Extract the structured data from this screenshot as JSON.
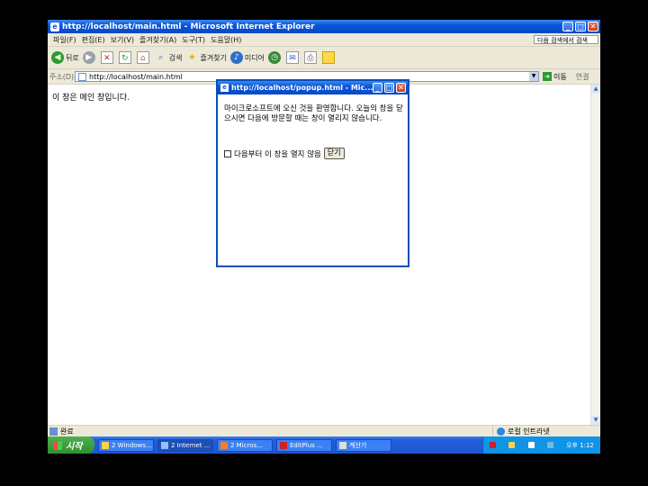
{
  "main_window": {
    "title": "http://localhost/main.html - Microsoft Internet Explorer",
    "menu": [
      "파일(F)",
      "편집(E)",
      "보기(V)",
      "즐겨찾기(A)",
      "도구(T)",
      "도움말(H)"
    ],
    "menu_right": "다음 검색에서 검색",
    "toolbar": {
      "back_label": "뒤로",
      "search_label": "검색",
      "favorites_label": "즐겨찾기",
      "media_label": "미디어"
    },
    "address": {
      "label": "주소(D)",
      "value": "http://localhost/main.html",
      "go_label": "이동",
      "links_label": "연결"
    },
    "content_text": "이 창은 메인 창입니다.",
    "status_text": "완료",
    "zone_text": "로컬 인트라넷"
  },
  "popup": {
    "title": "http://localhost/popup.html - Mic...",
    "message": "마이크로소프트에 오신 것을 환영합니다. 오늘의 창을 닫으시면 다음에 방문할 때는 창이 열리지 않습니다.",
    "checkbox_label": "다음부터 이 창을 열지 않음",
    "close_button": "닫기"
  },
  "taskbar": {
    "start_label": "시작",
    "tasks": [
      "2 Windows...",
      "2 Internet ...",
      "2 Micros...",
      "EditPlus ...",
      "계산기"
    ],
    "active_task_index": 1,
    "time": "오후 1:12"
  },
  "colors": {
    "titlebar_blue": "#0a55d8",
    "taskbar_blue": "#245edb",
    "start_green": "#2f8f2f",
    "xp_beige": "#ece9d8"
  },
  "icons": [
    "ie-icon",
    "back-icon",
    "forward-icon",
    "stop-icon",
    "refresh-icon",
    "home-icon",
    "search-icon",
    "favorites-star-icon",
    "media-icon",
    "history-icon",
    "mail-icon",
    "print-icon",
    "edit-icon",
    "go-arrow-icon",
    "globe-icon"
  ]
}
